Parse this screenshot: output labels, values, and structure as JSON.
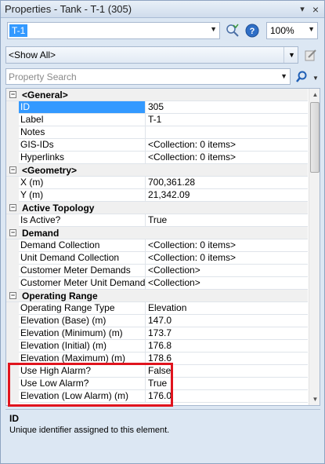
{
  "window": {
    "title": "Properties - Tank - T-1 (305)",
    "pin_glyph": "▾",
    "close_glyph": "×"
  },
  "toolbar": {
    "element_selected": "T-1",
    "zoom_value": "100%"
  },
  "filter": {
    "value": "<Show All>"
  },
  "search": {
    "placeholder": "Property Search"
  },
  "grid": {
    "categories": {
      "general": "<General>",
      "geometry": "<Geometry>",
      "active_topology": "Active Topology",
      "demand": "Demand",
      "operating_range": "Operating Range"
    },
    "rows": {
      "id": {
        "name": "ID",
        "value": "305"
      },
      "label": {
        "name": "Label",
        "value": "T-1"
      },
      "notes": {
        "name": "Notes",
        "value": ""
      },
      "gis_ids": {
        "name": "GIS-IDs",
        "value": "<Collection: 0 items>"
      },
      "hyperlinks": {
        "name": "Hyperlinks",
        "value": "<Collection: 0 items>"
      },
      "x": {
        "name": "X (m)",
        "value": "700,361.28"
      },
      "y": {
        "name": "Y (m)",
        "value": "21,342.09"
      },
      "is_active": {
        "name": "Is Active?",
        "value": "True"
      },
      "demand_collection": {
        "name": "Demand Collection",
        "value": "<Collection: 0 items>"
      },
      "unit_demand_collection": {
        "name": "Unit Demand Collection",
        "value": "<Collection: 0 items>"
      },
      "customer_meter_demands": {
        "name": "Customer Meter Demands",
        "value": "<Collection>"
      },
      "customer_meter_unit_demands": {
        "name": "Customer Meter Unit Demands",
        "value": "<Collection>"
      },
      "operating_range_type": {
        "name": "Operating Range Type",
        "value": "Elevation"
      },
      "elev_base": {
        "name": "Elevation (Base) (m)",
        "value": "147.0"
      },
      "elev_min": {
        "name": "Elevation (Minimum) (m)",
        "value": "173.7"
      },
      "elev_initial": {
        "name": "Elevation (Initial) (m)",
        "value": "176.8"
      },
      "elev_max": {
        "name": "Elevation (Maximum) (m)",
        "value": "178.6"
      },
      "use_high_alarm": {
        "name": "Use High Alarm?",
        "value": "False"
      },
      "use_low_alarm": {
        "name": "Use Low Alarm?",
        "value": "True"
      },
      "elev_low_alarm": {
        "name": "Elevation (Low Alarm) (m)",
        "value": "176.0"
      }
    }
  },
  "description": {
    "title": "ID",
    "text": "Unique identifier assigned to this element."
  },
  "colors": {
    "selection": "#3399ff",
    "highlight_box": "#e0141e",
    "panel_bg": "#dce7f3"
  }
}
